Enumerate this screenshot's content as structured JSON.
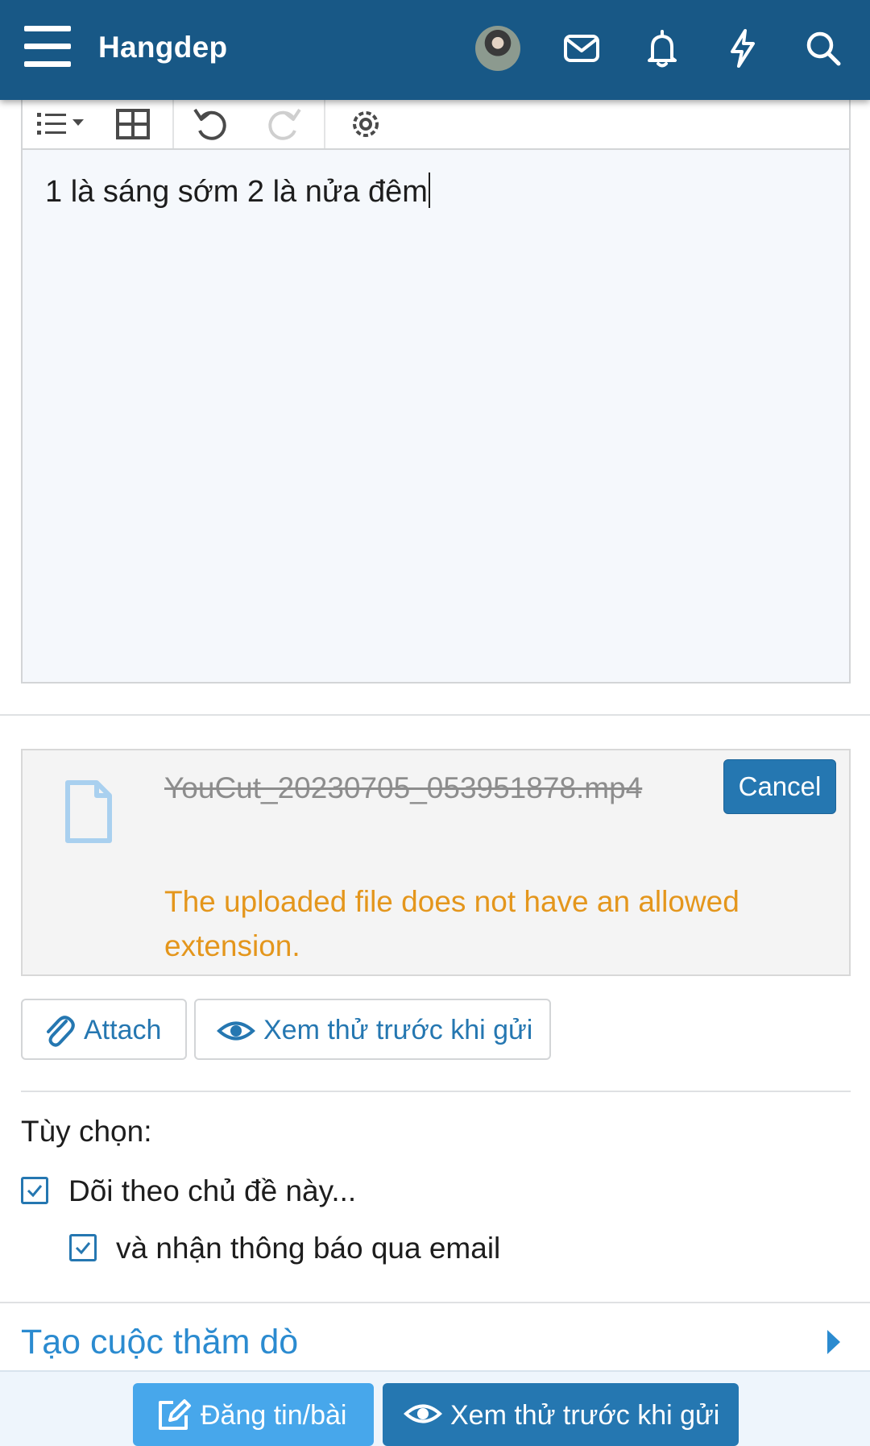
{
  "header": {
    "brand": "Hangdep",
    "icons": [
      "menu-icon",
      "avatar",
      "mail-icon",
      "bell-icon",
      "bolt-icon",
      "search-icon"
    ],
    "bar_color": "#185886"
  },
  "editor": {
    "toolbar_icons": [
      "list-icon",
      "table-icon",
      "undo-icon",
      "redo-icon",
      "settings-icon"
    ],
    "content": "1 là sáng sớm 2 là nửa đêm"
  },
  "attachment": {
    "file_name": "YouCut_20230705_053951878.mp4",
    "cancel_label": "Cancel",
    "error": "The uploaded file does not have an allowed extension.",
    "error_color": "#e4961c"
  },
  "actions": {
    "attach_label": "Attach",
    "preview_label": "Xem thử trước khi gửi"
  },
  "options": {
    "title": "Tùy chọn:",
    "watch_label": "Dõi theo chủ đề này...",
    "watch_checked": true,
    "email_label": "và nhận thông báo qua email",
    "email_checked": true
  },
  "poll": {
    "label": "Tạo cuộc thăm dò"
  },
  "footer": {
    "post_label": "Đăng tin/bài",
    "preview_label": "Xem thử trước khi gửi",
    "accent": "#2577b1"
  }
}
